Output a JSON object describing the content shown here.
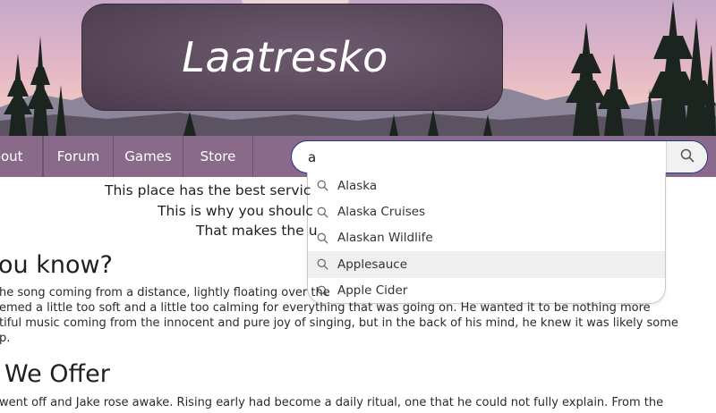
{
  "site": {
    "logo_text": "Laatresko"
  },
  "nav": {
    "items": [
      {
        "label": "bout"
      },
      {
        "label": "Forum"
      },
      {
        "label": "Games"
      },
      {
        "label": "Store"
      }
    ]
  },
  "search": {
    "value": "a",
    "button_icon": "search-icon",
    "suggestions": [
      {
        "label": "Alaska"
      },
      {
        "label": "Alaska Cruises"
      },
      {
        "label": "Alaskan Wildlife"
      },
      {
        "label": "Applesauce",
        "highlighted": true
      },
      {
        "label": "Apple Cider"
      }
    ]
  },
  "content": {
    "intro_lines": [
      "This place has the best servic",
      "This is why you shoulc",
      "That makes the u"
    ],
    "section1": {
      "heading": "ou know?",
      "lines": [
        "he song coming from a distance, lightly floating over the",
        "emed a little too soft and a little too calming for everything that was going on. He wanted it to be nothing more",
        "tiful music coming from the innocent and pure joy of singing, but in the back of his mind, he knew it was likely some",
        "p."
      ]
    },
    "section2": {
      "heading": "We Offer",
      "lines": [
        "went off and Jake rose awake. Rising early had become a daily ritual, one that he could not fully explain. From the"
      ]
    }
  },
  "colors": {
    "nav_bg": "#8a6a8b",
    "logo_box": "#5b4a5c",
    "search_border": "#1e3a8a",
    "highlight_row": "#efefef"
  }
}
